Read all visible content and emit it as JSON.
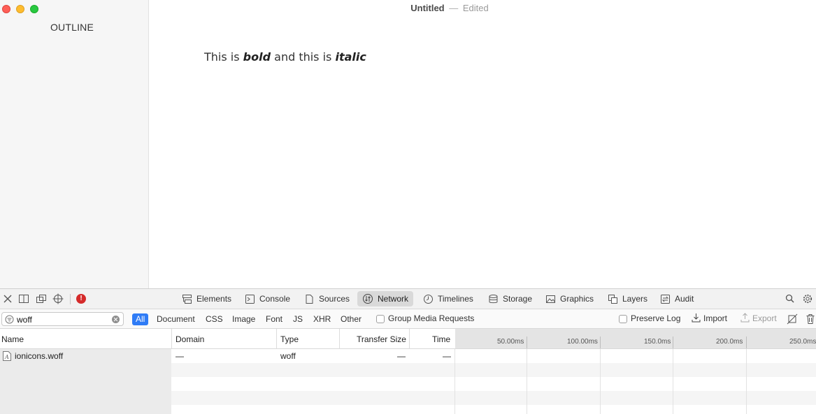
{
  "window": {
    "title": "Untitled",
    "separator": "—",
    "status": "Edited"
  },
  "sidebar": {
    "title": "OUTLINE"
  },
  "document": {
    "text_prefix": "This is ",
    "bold_word": "bold",
    "text_middle": " and this is ",
    "italic_word": "italic"
  },
  "devtools": {
    "tabs": [
      {
        "label": "Elements",
        "icon": "elements-icon"
      },
      {
        "label": "Console",
        "icon": "console-icon"
      },
      {
        "label": "Sources",
        "icon": "sources-icon"
      },
      {
        "label": "Network",
        "icon": "network-icon",
        "active": true
      },
      {
        "label": "Timelines",
        "icon": "timelines-icon"
      },
      {
        "label": "Storage",
        "icon": "storage-icon"
      },
      {
        "label": "Graphics",
        "icon": "graphics-icon"
      },
      {
        "label": "Layers",
        "icon": "layers-icon"
      },
      {
        "label": "Audit",
        "icon": "audit-icon"
      }
    ],
    "error_badge": "!",
    "filter": {
      "search_value": "woff",
      "types": [
        "All",
        "Document",
        "CSS",
        "Image",
        "Font",
        "JS",
        "XHR",
        "Other"
      ],
      "active_type": "All",
      "group_media_label": "Group Media Requests",
      "preserve_log_label": "Preserve Log",
      "import_label": "Import",
      "export_label": "Export"
    },
    "columns": [
      "Name",
      "Domain",
      "Type",
      "Transfer Size",
      "Time"
    ],
    "timeline_ticks": [
      "50.00ms",
      "100.00ms",
      "150.0ms",
      "200.0ms",
      "250.0ms"
    ],
    "requests": [
      {
        "name": "ionicons.woff",
        "domain": "—",
        "type": "woff",
        "transfer_size": "—",
        "time": "—"
      }
    ]
  },
  "colors": {
    "accent": "#2f7cf6",
    "error": "#d52b2b",
    "close": "#fe5f57",
    "minimize": "#febc2e",
    "maximize": "#28c840"
  }
}
